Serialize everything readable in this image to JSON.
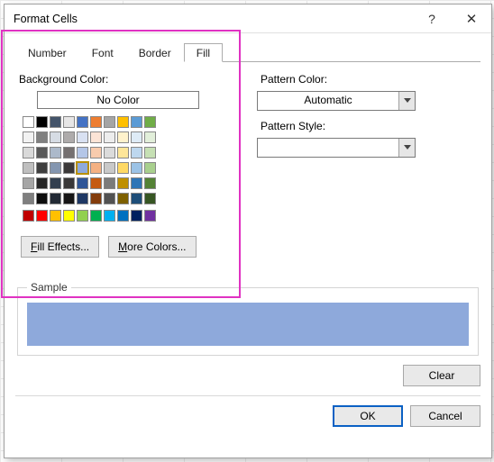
{
  "window": {
    "title": "Format Cells",
    "help_icon": "?",
    "close_icon": "✕"
  },
  "tabs": {
    "number": "Number",
    "font": "Font",
    "border": "Border",
    "fill": "Fill"
  },
  "left": {
    "background_label": "Background Color:",
    "no_color": "No Color",
    "fill_effects": "Fill Effects...",
    "more_colors": "More Colors...",
    "theme_row1": [
      "#ffffff",
      "#000000",
      "#44546a",
      "#e7e6e6",
      "#4472c4",
      "#ed7d31",
      "#a5a5a5",
      "#ffc000",
      "#5b9bd5",
      "#70ad47"
    ],
    "theme_grid": [
      [
        "#f2f2f2",
        "#808080",
        "#d6dce4",
        "#aeabab",
        "#d9e1f2",
        "#fce4d6",
        "#ededed",
        "#fff2cc",
        "#deebf6",
        "#e2efda"
      ],
      [
        "#d9d9d9",
        "#595959",
        "#acb9ca",
        "#757070",
        "#b4c6e7",
        "#f8cbad",
        "#dbdbdb",
        "#fee699",
        "#bdd7ee",
        "#c6e0b4"
      ],
      [
        "#bfbfbf",
        "#3f3f3f",
        "#8496b0",
        "#3b3838",
        "#8ea9db",
        "#f4b183",
        "#c9c9c9",
        "#ffd964",
        "#9cc3e6",
        "#a9d08e"
      ],
      [
        "#a6a6a6",
        "#262626",
        "#323f4f",
        "#3a3838",
        "#2f5597",
        "#c55a11",
        "#7b7b7b",
        "#bf9000",
        "#2e75b6",
        "#548235"
      ],
      [
        "#7f7f7f",
        "#0d0d0d",
        "#222a35",
        "#171616",
        "#1f3864",
        "#833c0b",
        "#525252",
        "#7e6000",
        "#1e4e79",
        "#375623"
      ]
    ],
    "standard_row": [
      "#c00000",
      "#ff0000",
      "#ffc000",
      "#ffff00",
      "#92d050",
      "#00b050",
      "#00b0f0",
      "#0070c0",
      "#002060",
      "#7030a0"
    ],
    "selected_color": "#8ea9db"
  },
  "right": {
    "pattern_color_label": "Pattern Color:",
    "pattern_color_value": "Automatic",
    "pattern_style_label": "Pattern Style:",
    "pattern_style_value": ""
  },
  "sample": {
    "legend": "Sample",
    "color": "#8ea9db"
  },
  "buttons": {
    "clear": "Clear",
    "ok": "OK",
    "cancel": "Cancel"
  }
}
